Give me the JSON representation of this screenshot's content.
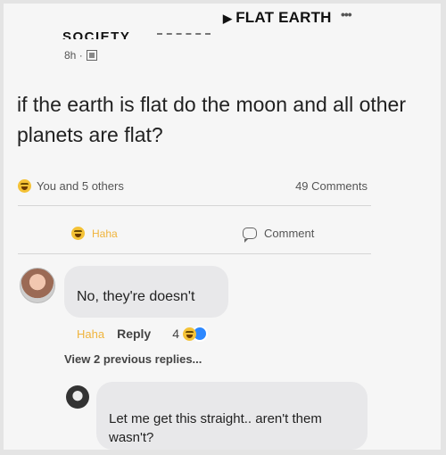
{
  "post": {
    "group_name": "FLAT EARTH",
    "author": "SOCIETY",
    "time": "8h",
    "text": "if the earth is flat do the moon and all other planets are flat?",
    "reactions_text": "You and 5 others",
    "comments_count": "49 Comments"
  },
  "actions": {
    "haha_label": "Haha",
    "comment_label": "Comment"
  },
  "comments": [
    {
      "text": "No, they're doesn't",
      "reaction_label": "Haha",
      "reply_label": "Reply",
      "reaction_count": "4"
    }
  ],
  "view_previous_replies": "View 2 previous replies...",
  "reply": {
    "text": "Let me get this straight.. aren't them wasn't?"
  },
  "colors": {
    "haha_accent": "#f0b43c",
    "bubble_bg": "#e8e8ea",
    "badge_blue": "#2d88ff"
  }
}
